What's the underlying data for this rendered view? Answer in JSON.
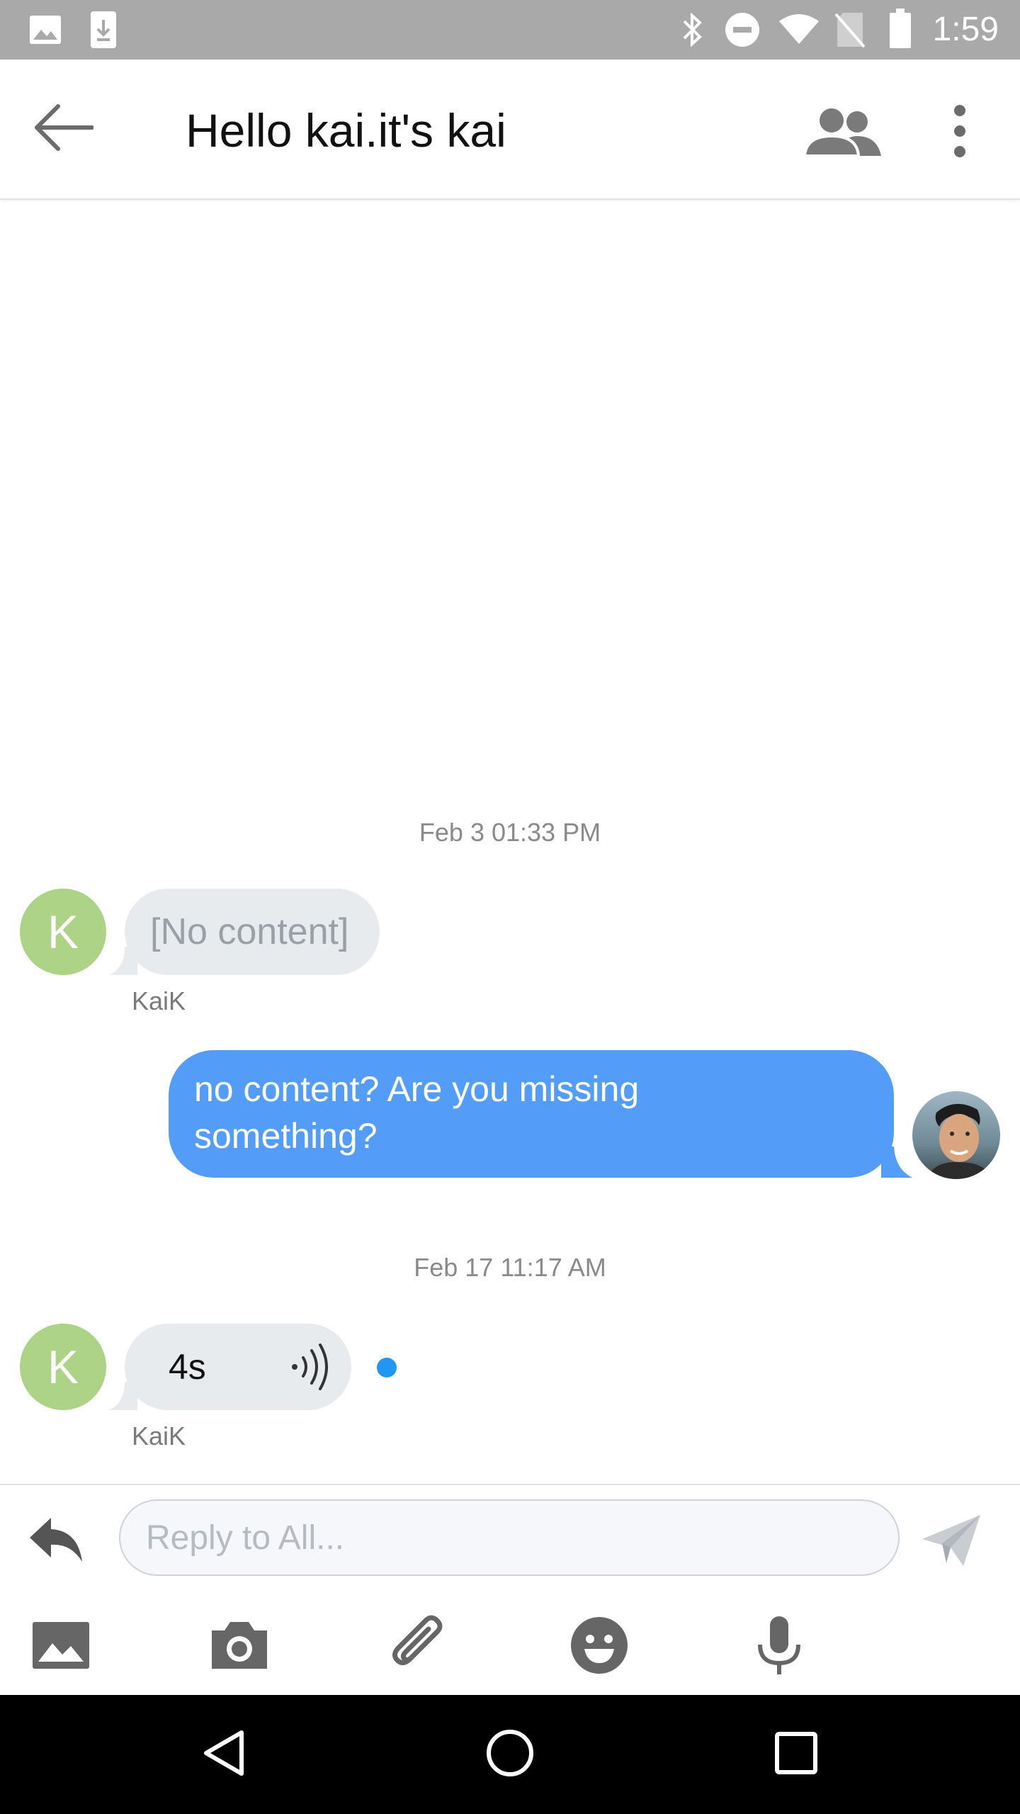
{
  "status_bar": {
    "time": "1:59",
    "left_icons": [
      "image-icon",
      "download-icon"
    ],
    "right_icons": [
      "bluetooth-icon",
      "do-not-disturb-icon",
      "wifi-icon",
      "no-sim-icon",
      "battery-icon"
    ]
  },
  "header": {
    "title": "Hello kai.it's kai",
    "icons": [
      "back-arrow-icon",
      "participants-icon",
      "more-vert-icon"
    ]
  },
  "messages": {
    "group1": {
      "timestamp": "Feb 3 01:33 PM",
      "incoming": {
        "avatar_letter": "K",
        "text": "[No content]",
        "sender": "KaiK"
      },
      "outgoing": {
        "text": "no content?  Are you missing something?"
      }
    },
    "group2": {
      "timestamp": "Feb 17 11:17 AM",
      "incoming_voice": {
        "avatar_letter": "K",
        "duration": "4s",
        "sender": "KaiK"
      }
    }
  },
  "composer": {
    "placeholder": "Reply to All...",
    "tools": [
      "gallery-icon",
      "camera-icon",
      "attach-icon",
      "emoji-icon",
      "microphone-icon"
    ]
  },
  "colors": {
    "accent": "#539df8",
    "avatar_green": "#acd386",
    "incoming_bubble": "#e8ebee",
    "status_bar": "#a9a9a9",
    "unread_dot": "#2196f3"
  }
}
